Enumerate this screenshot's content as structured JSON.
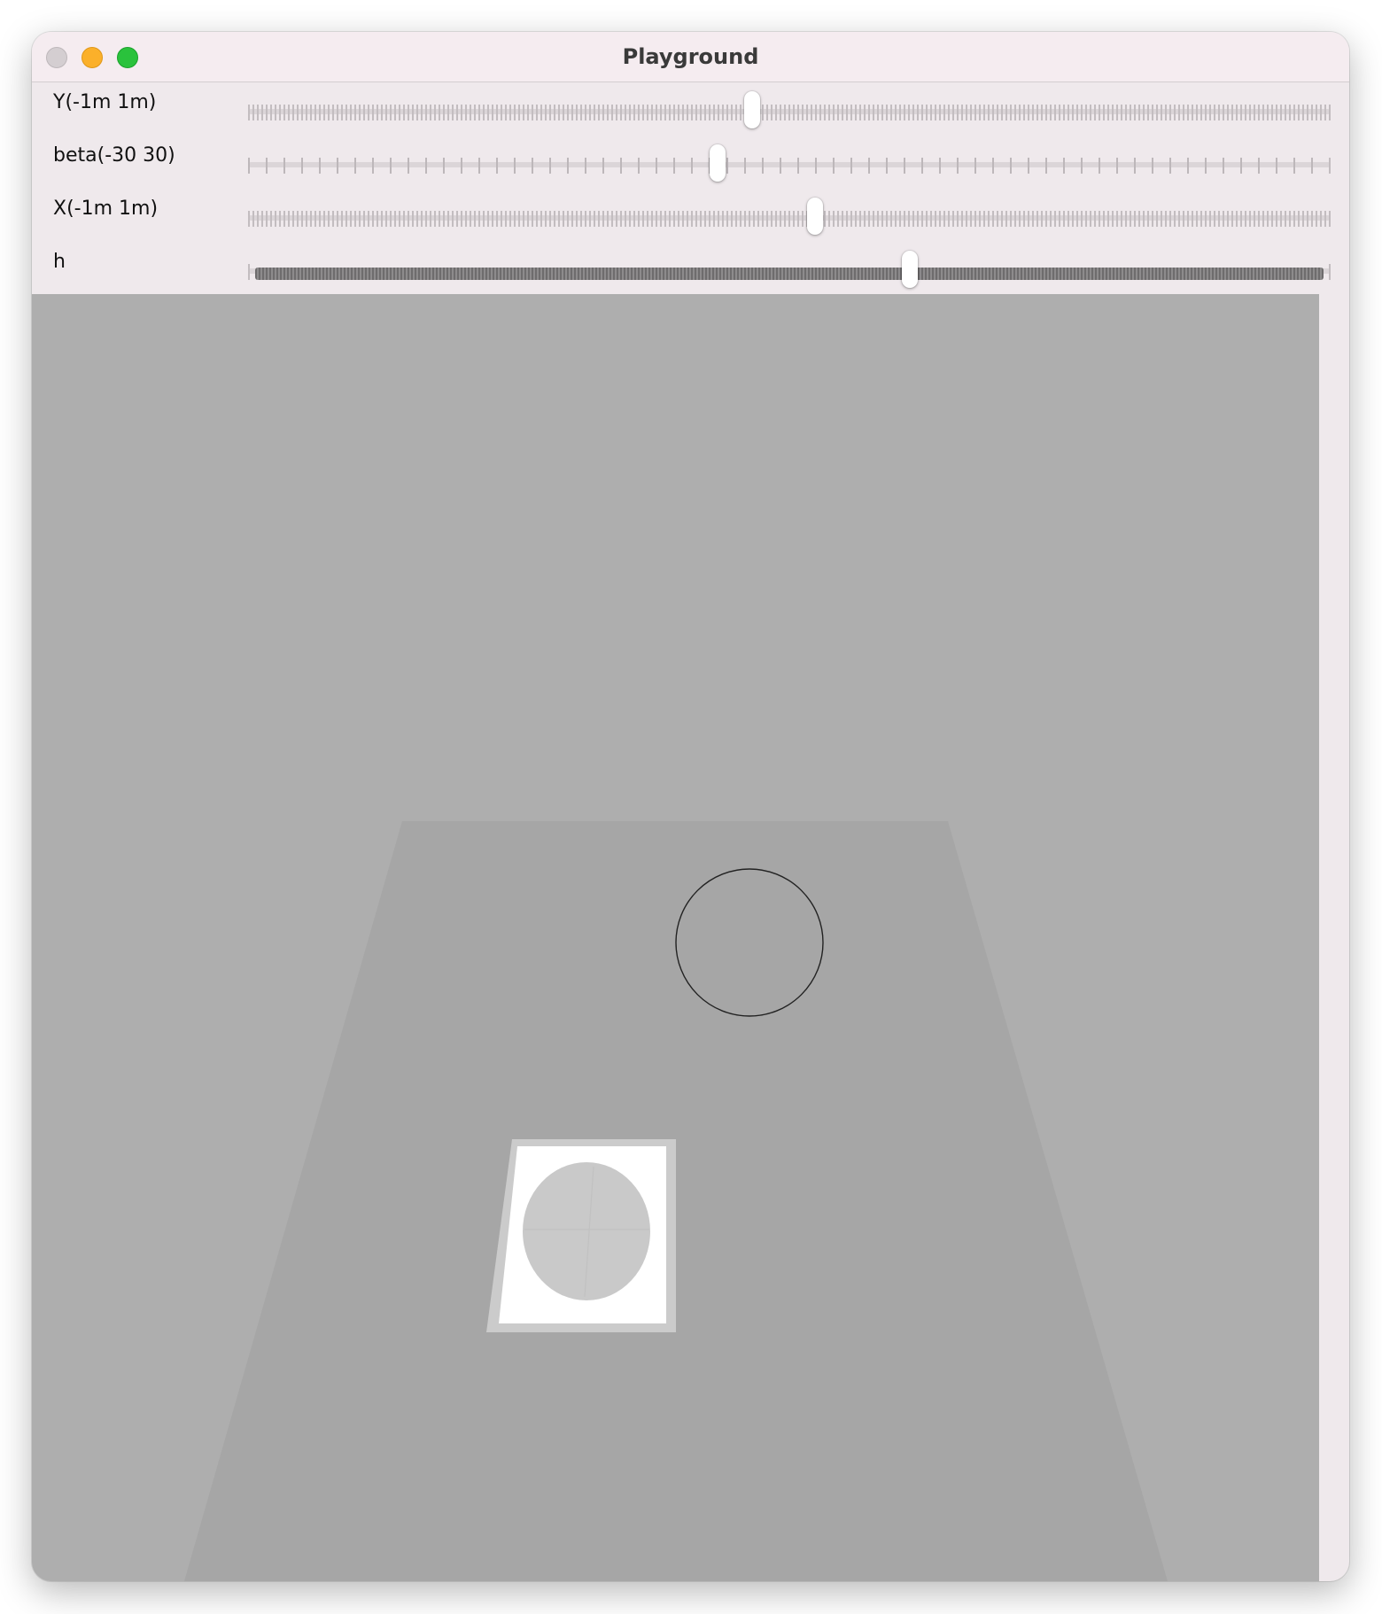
{
  "window": {
    "title": "Playground"
  },
  "traffic_lights": {
    "close": "close-button",
    "minimize": "minimize-button",
    "zoom": "zoom-button"
  },
  "sliders": [
    {
      "id": "y",
      "label": "Y(-1m 1m)",
      "value_fraction": 0.466,
      "ticks": "fine"
    },
    {
      "id": "beta",
      "label": "beta(-30 30)",
      "value_fraction": 0.434,
      "ticks": "coarse"
    },
    {
      "id": "x",
      "label": "X(-1m 1m)",
      "value_fraction": 0.524,
      "ticks": "fine"
    },
    {
      "id": "h",
      "label": "h",
      "value_fraction": 0.611,
      "ticks": "dense"
    }
  ],
  "colors": {
    "background": "#aeaeae",
    "floor": "#a6a6a6",
    "marker_frame": "#cbcbcb",
    "marker_paper": "#ffffff",
    "marker_disc": "#c9c9c9",
    "target_outline": "#222222"
  }
}
